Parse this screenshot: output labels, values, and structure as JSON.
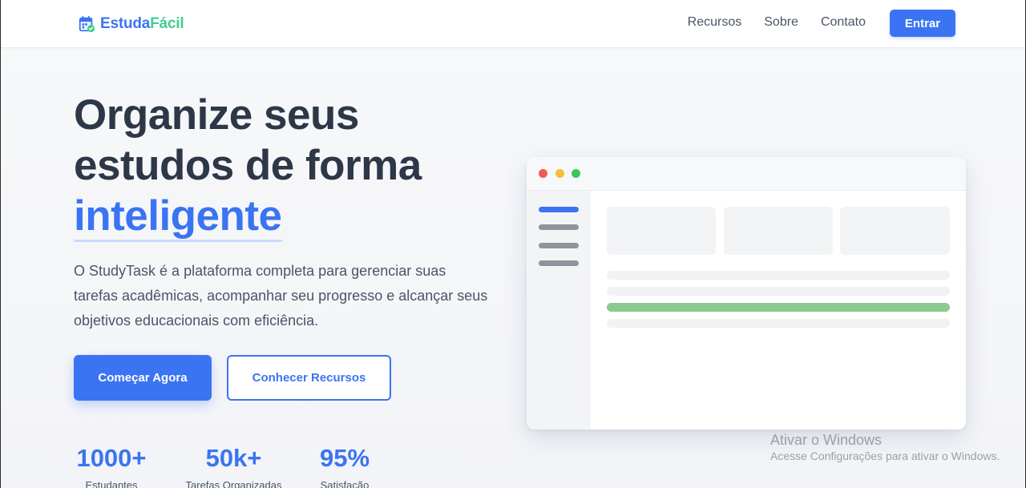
{
  "brand": {
    "name_part1": "Estuda",
    "name_part2": "Fácil",
    "icon": "calendar-check-icon",
    "colors": {
      "primary": "#3b74f2",
      "accent": "#3fcf8e"
    }
  },
  "nav": {
    "items": [
      {
        "label": "Recursos"
      },
      {
        "label": "Sobre"
      },
      {
        "label": "Contato"
      }
    ],
    "login_label": "Entrar"
  },
  "hero": {
    "title_line1": "Organize seus",
    "title_line2": "estudos de forma",
    "title_highlight": "inteligente",
    "description": "O StudyTask é a plataforma completa para gerenciar suas tarefas acadêmicas, acompanhar seu progresso e alcançar seus objetivos educacionais com eficiência.",
    "primary_button": "Começar Agora",
    "secondary_button": "Conhecer Recursos"
  },
  "stats": [
    {
      "value": "1000+",
      "label": "Estudantes"
    },
    {
      "value": "50k+",
      "label": "Tarefas Organizadas"
    },
    {
      "value": "95%",
      "label": "Satisfação"
    }
  ],
  "mockup": {
    "window_dots": [
      "#f25c54",
      "#f4bf3a",
      "#3ec55a"
    ],
    "progress_color": "#8ccb8f"
  },
  "watermark": {
    "line1": "Ativar o Windows",
    "line2": "Acesse Configurações para ativar o Windows."
  }
}
